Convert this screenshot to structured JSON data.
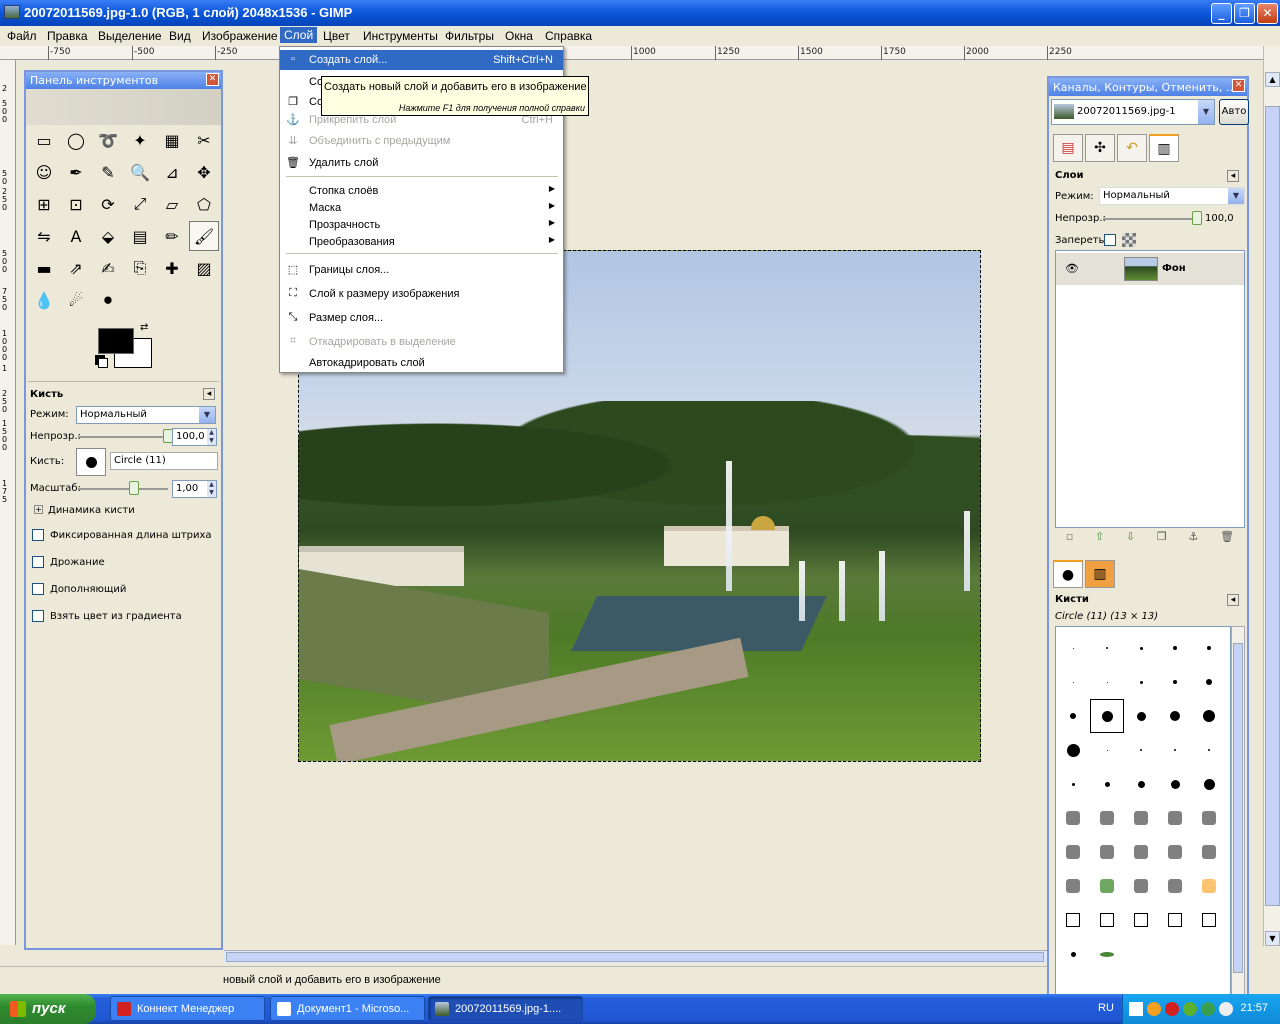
{
  "window": {
    "title": "20072011569.jpg-1.0 (RGB, 1 слой) 2048x1536 - GIMP",
    "minimize": "_",
    "maximize": "❐",
    "close": "✕"
  },
  "menubar": [
    "Файл",
    "Правка",
    "Выделение",
    "Вид",
    "Изображение",
    "Слой",
    "Цвет",
    "Инструменты",
    "Фильтры",
    "Окна",
    "Справка"
  ],
  "ruler_top": [
    "-750",
    "-500",
    "-250",
    "1000",
    "1250",
    "1500",
    "1750",
    "2000",
    "2250"
  ],
  "ruler_left": [
    "2",
    "5",
    "0",
    "0",
    "5",
    "0",
    "2",
    "5",
    "0",
    "5",
    "0",
    "0",
    "7",
    "5",
    "0",
    "1",
    "0",
    "0",
    "0",
    "1",
    "2",
    "5",
    "0",
    "1",
    "5",
    "0",
    "0",
    "1",
    "7",
    "5"
  ],
  "layer_menu": {
    "items": [
      {
        "label": "Создать слой...",
        "shortcut": "Shift+Ctrl+N",
        "icon": "new-layer-icon",
        "state": "highlighted"
      },
      {
        "label": "Создать из видимого",
        "shortcut": "",
        "icon": "",
        "state": "normal"
      },
      {
        "label": "Создать копию слоя",
        "shortcut": "",
        "icon": "duplicate-layer-icon",
        "state": "normal"
      },
      {
        "label": "Прикрепить слой",
        "shortcut": "Ctrl+H",
        "icon": "anchor-icon",
        "state": "disabled"
      },
      {
        "label": "Объединить с предыдущим",
        "shortcut": "",
        "icon": "merge-down-icon",
        "state": "disabled"
      },
      {
        "label": "Удалить слой",
        "shortcut": "",
        "icon": "trash-icon",
        "state": "normal"
      }
    ],
    "submenus": [
      "Стопка слоёв",
      "Маска",
      "Прозрачность",
      "Преобразования"
    ],
    "bottom_items": [
      {
        "label": "Границы слоя...",
        "icon": "layer-boundary-icon",
        "state": "normal"
      },
      {
        "label": "Слой к размеру изображения",
        "icon": "layer-to-image-size-icon",
        "state": "normal"
      },
      {
        "label": "Размер слоя...",
        "icon": "scale-layer-icon",
        "state": "normal"
      },
      {
        "label": "Откадрировать в выделение",
        "icon": "crop-icon",
        "state": "disabled"
      },
      {
        "label": "Автокадрировать слой",
        "icon": "",
        "state": "normal"
      }
    ]
  },
  "tooltip": {
    "text": "Создать новый слой и добавить его в изображение",
    "help": "Нажмите F1 для получения полной справки"
  },
  "toolbox": {
    "title": "Панель инструментов",
    "tools": [
      "rect-select-icon",
      "ellipse-select-icon",
      "lasso-icon",
      "fuzzy-select-icon",
      "color-select-icon",
      "scissors-icon",
      "foreground-select-icon",
      "paths-icon",
      "color-picker-icon",
      "zoom-icon",
      "measure-icon",
      "move-icon",
      "align-icon",
      "crop-icon",
      "rotate-icon",
      "scale-icon",
      "shear-icon",
      "perspective-icon",
      "flip-icon",
      "text-icon",
      "bucket-fill-icon",
      "blend-icon",
      "pencil-icon",
      "paintbrush-icon",
      "eraser-icon",
      "airbrush-icon",
      "ink-icon",
      "clone-icon",
      "heal-icon",
      "perspective-clone-icon",
      "blur-icon",
      "smudge-icon",
      "dodge-burn-icon"
    ],
    "tool_glyphs": [
      "▭",
      "◯",
      "➰",
      "✦",
      "▦",
      "✂",
      "☺",
      "✒",
      "✎",
      "🔍",
      "⊿",
      "✥",
      "⊞",
      "⊡",
      "⟳",
      "⤢",
      "▱",
      "⬠",
      "⇋",
      "A",
      "⬙",
      "▤",
      "✏",
      "🖌",
      "▬",
      "⇗",
      "✍",
      "⎘",
      "✚",
      "▨",
      "💧",
      "☄",
      "⚫"
    ],
    "selected_tool": 23,
    "options": {
      "title": "Кисть",
      "mode_label": "Режим:",
      "mode_value": "Нормальный",
      "opacity_label": "Непрозр.:",
      "opacity_value": "100,0",
      "opacity_fraction": 1.0,
      "brush_label": "Кисть:",
      "brush_value": "Circle (11)",
      "scale_label": "Масштаб:",
      "scale_value": "1,00",
      "dynamics_label": "Динамика кисти",
      "checks": [
        "Фиксированная длина штриха",
        "Дрожание",
        "Дополняющий",
        "Взять цвет из градиента"
      ]
    }
  },
  "dock": {
    "title": "Каналы, Контуры, Отменить, ...",
    "image_name": "20072011569.jpg-1",
    "auto_label": "Авто",
    "layers_title": "Слои",
    "mode_label": "Режим:",
    "mode_value": "Нормальный",
    "opacity_label": "Непрозр.:",
    "opacity_value": "100,0",
    "lock_label": "Запереть:",
    "layer_name": "Фон",
    "brushes_title": "Кисти",
    "brush_current": "Circle (11) (13 × 13)"
  },
  "status": {
    "message": "новый слой и добавить его в изображение"
  },
  "taskbar": {
    "start": "пуск",
    "tasks": [
      "Коннект Менеджер",
      "Документ1 - Microso...",
      "20072011569.jpg-1...."
    ],
    "lang": "RU",
    "time": "21:57"
  }
}
